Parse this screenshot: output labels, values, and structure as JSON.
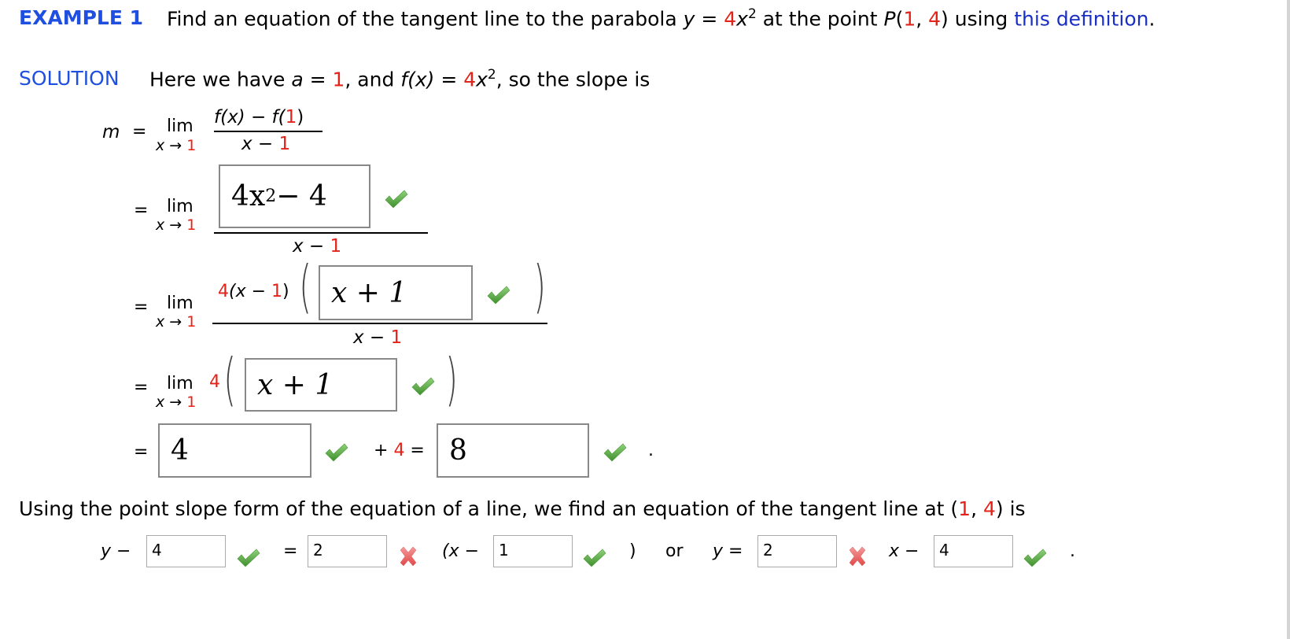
{
  "header": {
    "example_label": "EXAMPLE 1",
    "problem_text_1": "Find an equation of the tangent line to the parabola ",
    "y_var": "y",
    "eq": " = ",
    "coef": "4",
    "x_var": "x",
    "exp": "2",
    "problem_text_2": " at the point ",
    "P": "P",
    "open_paren": "(",
    "px": "1",
    "comma": ", ",
    "py": "4",
    "close_paren": ")",
    "problem_text_3": " using ",
    "link_text": "this definition",
    "period": "."
  },
  "solution": {
    "label": "SOLUTION",
    "text_1": "Here we have ",
    "a_var": "a",
    "eq": " = ",
    "a_val": "1",
    "text_2": ", and ",
    "f_of_x": "f(x)",
    "coef": "4",
    "x_var": "x",
    "exp": "2",
    "text_3": ", so the slope is"
  },
  "steps": {
    "m_label": "m",
    "equals": "=",
    "lim": "lim",
    "lim_sub_x": "x → ",
    "lim_sub_val": "1",
    "step1": {
      "num_a": "f(x) − f(",
      "num_val": "1",
      "num_b": ")",
      "den_a": "x − ",
      "den_val": "1"
    },
    "step2": {
      "answer": "4x² − 4",
      "answer_base": "4x",
      "answer_exp": "2",
      "answer_rest": " − 4",
      "status": "correct",
      "den_a": "x − ",
      "den_val": "1"
    },
    "step3": {
      "prefix_coef": "4",
      "prefix_a": "(x − ",
      "prefix_val": "1",
      "prefix_b": ")",
      "answer": "x + 1",
      "status": "correct",
      "den_a": "x − ",
      "den_val": "1"
    },
    "step4": {
      "prefix_coef": "4",
      "answer": "x + 1",
      "status": "correct"
    },
    "step5": {
      "answer1": "4",
      "status1": "correct",
      "plus": "+ ",
      "plus_val": "4",
      "eq": " =",
      "answer2": "8",
      "status2": "correct",
      "period": "."
    }
  },
  "conclusion": {
    "text": "Using the point slope form of the equation of a line, we find an equation of the tangent line at ",
    "open": "(",
    "x": "1",
    "comma": ", ",
    "y": "4",
    "close": ")",
    "tail": " is"
  },
  "final_line": {
    "y_minus": "y −",
    "input1": "4",
    "status1": "correct",
    "equals": "=",
    "input2": "2",
    "status2": "incorrect",
    "x_minus": "(x −",
    "input3": "1",
    "status3": "correct",
    "close_paren": ")",
    "or": "or",
    "y_eq": "y =",
    "input4": "2",
    "status4": "incorrect",
    "x_minus2": "x −",
    "input5": "4",
    "status5": "correct",
    "period": "."
  },
  "colors": {
    "heading_blue": "#1f4fe0",
    "link_blue": "#1a2fc4",
    "given_red": "#e2231a",
    "check_green": "#5aa842",
    "cross_red": "#ec6a6a",
    "box_border": "#888888"
  }
}
